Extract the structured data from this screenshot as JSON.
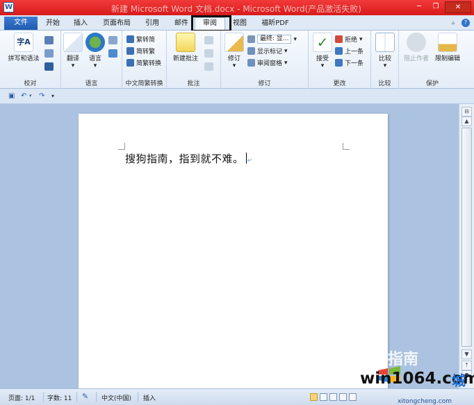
{
  "window": {
    "title": "新建 Microsoft Word 文档.docx - Microsoft Word(产品激活失败)",
    "app_icon_letter": "W",
    "buttons": [
      "─",
      "❐",
      "✕"
    ]
  },
  "tabs": [
    {
      "label": "文件"
    },
    {
      "label": "开始"
    },
    {
      "label": "插入"
    },
    {
      "label": "页面布局"
    },
    {
      "label": "引用"
    },
    {
      "label": "邮件"
    },
    {
      "label": "审阅"
    },
    {
      "label": "视图"
    },
    {
      "label": "福昕PDF"
    }
  ],
  "active_tab": "审阅",
  "ribbon": {
    "proofing": {
      "label": "校对",
      "spelling": "拼写和语法",
      "spelling_icon_text": "字A"
    },
    "language": {
      "label": "语言",
      "translate": "翻译",
      "language_btn": "语言"
    },
    "chinese_conversion": {
      "label": "中文简繁转换",
      "items": [
        "繁转简",
        "简转繁",
        "简繁转换"
      ]
    },
    "comments": {
      "label": "批注",
      "new_comment": "新建批注"
    },
    "tracking": {
      "label": "修订",
      "track_changes": "修订",
      "display_dropdown": "最终: 显...",
      "show_markup": "显示标记",
      "reviewing_pane": "审阅窗格"
    },
    "changes": {
      "label": "更改",
      "accept": "接受",
      "reject": "拒绝",
      "previous": "上一条",
      "next": "下一条"
    },
    "compare": {
      "label": "比较",
      "compare_btn": "比较"
    },
    "protect": {
      "label": "保护",
      "block_authors": "阻止作者",
      "restrict_editing": "限制编辑"
    }
  },
  "document": {
    "text": "搜狗指南，指到就不难。",
    "paragraph_mark": "↵"
  },
  "watermark": {
    "sogou": "搜狗指南",
    "site": "win1064.com",
    "site_suffix": "城",
    "site_url": "xitongcheng.com"
  },
  "statusbar": {
    "page": "页面: 1/1",
    "words": "字数: 11",
    "language": "中文(中国)",
    "mode": "插入"
  },
  "colors": {
    "title_bar": "#e32626",
    "file_tab": "#2a66bd",
    "ribbon_bg": "#eef3fa",
    "doc_bg": "#abc3e0",
    "highlight_box": "#111111"
  }
}
